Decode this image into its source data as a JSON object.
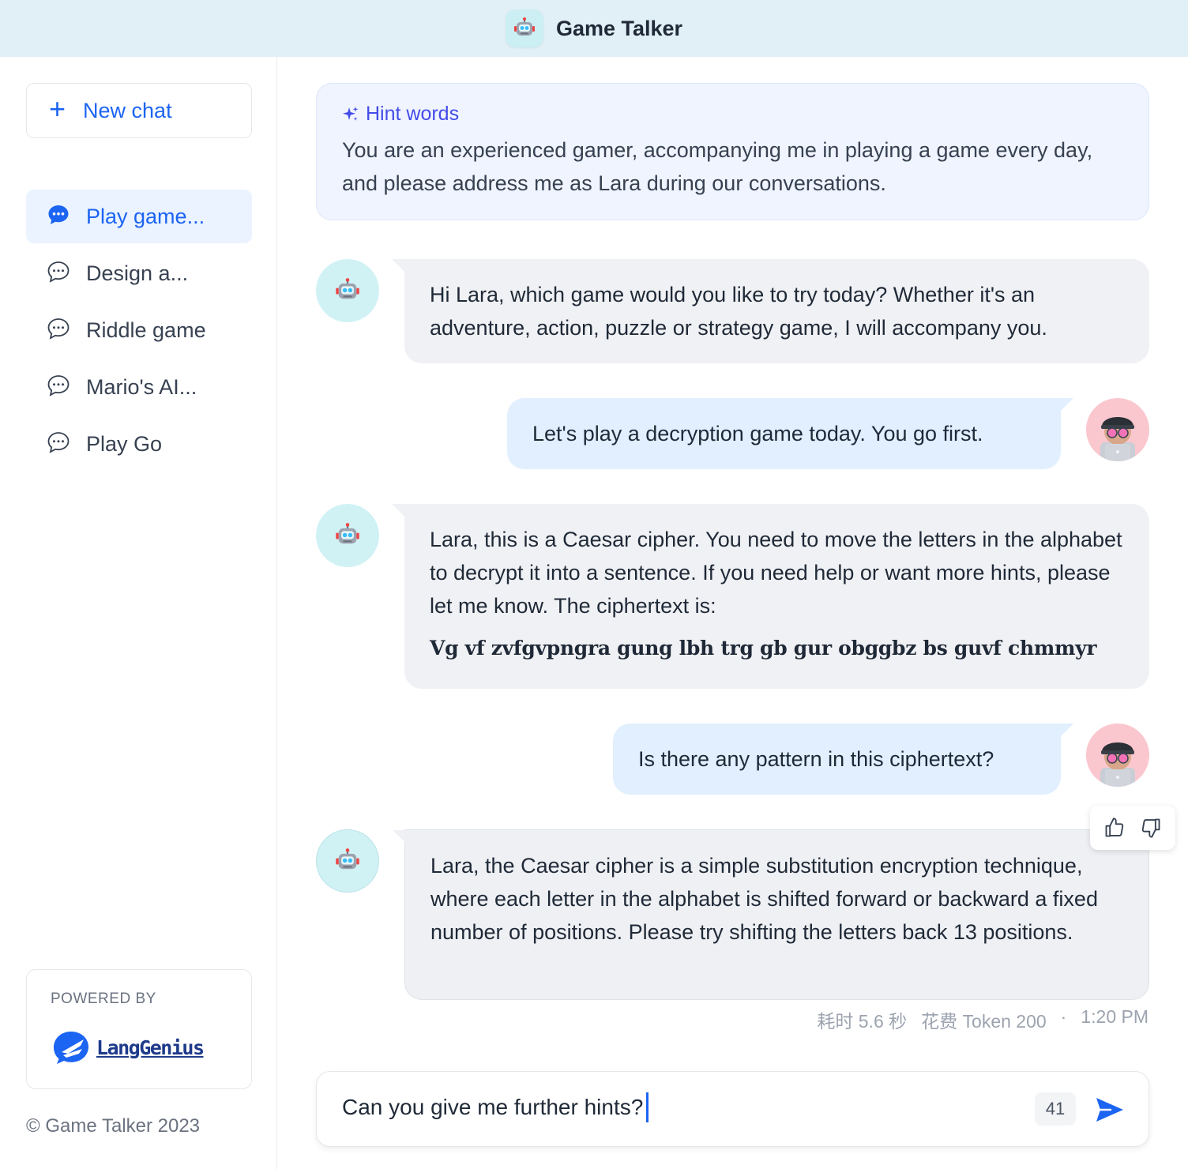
{
  "header": {
    "title": "Game Talker",
    "logo_icon": "robot-icon"
  },
  "sidebar": {
    "new_chat_label": "New chat",
    "conversations": [
      {
        "label": "Play game...",
        "active": true
      },
      {
        "label": "Design a...",
        "active": false
      },
      {
        "label": "Riddle game",
        "active": false
      },
      {
        "label": "Mario's AI...",
        "active": false
      },
      {
        "label": "Play Go",
        "active": false
      }
    ],
    "powered_by_label": "POWERED BY",
    "powered_by_brand": "LangGenius",
    "copyright": "© Game Talker 2023"
  },
  "hint": {
    "title": "Hint words",
    "text": "You are an experienced gamer, accompanying me in playing a game every day, and please address me as Lara during our conversations."
  },
  "messages": [
    {
      "role": "bot",
      "text": "Hi Lara, which game would you like to try today? Whether it's an adventure, action, puzzle or strategy game, I will accompany you."
    },
    {
      "role": "user",
      "text": "Let's play a decryption game today. You go first."
    },
    {
      "role": "bot",
      "text": "Lara, this is a Caesar cipher. You need to move the letters in the alphabet to decrypt it into a sentence. If you need help or want more hints, please let me know. The ciphertext is:",
      "cipher": "Vg vf zvfgvpngra gung lbh trg gb gur obggbz bs guvf chmmyr"
    },
    {
      "role": "user",
      "text": "Is there any pattern in this ciphertext?"
    },
    {
      "role": "bot",
      "text": "Lara, the Caesar cipher is a simple substitution encryption technique, where each letter in the alphabet is shifted forward or backward a fixed number of positions. Please try shifting the letters back 13 positions."
    }
  ],
  "last_message_meta": {
    "time_cost": "耗时 5.6 秒",
    "token_cost": "花费 Token 200",
    "separator": "·",
    "timestamp": "1:20 PM"
  },
  "composer": {
    "value": "Can you give me further hints?",
    "char_count": "41"
  },
  "colors": {
    "accent": "#1c64f2",
    "hint_accent": "#444ce7",
    "bot_bubble": "#f0f1f4",
    "user_bubble": "#e1effe",
    "topbar": "#e1eff6"
  }
}
